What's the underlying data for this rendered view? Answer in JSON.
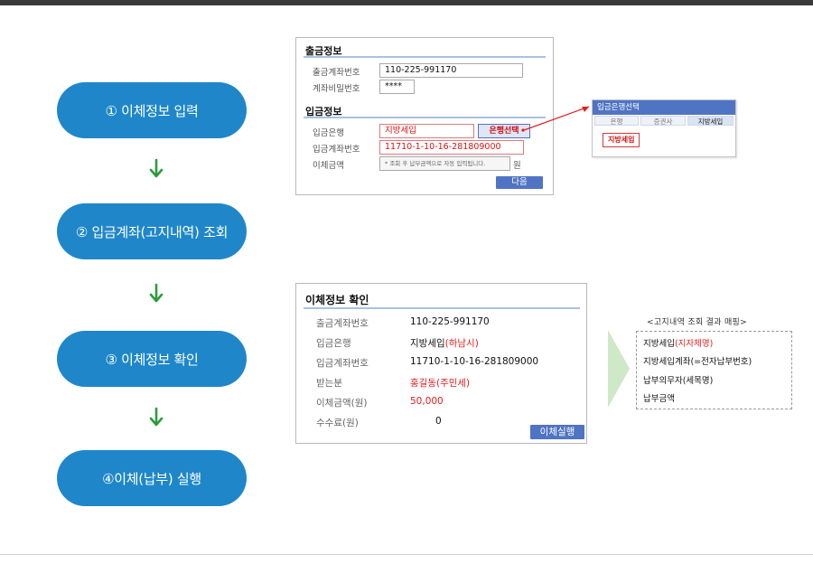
{
  "steps": [
    {
      "label": "① 이체정보 입력"
    },
    {
      "label": "② 입금계좌(고지내역) 조회"
    },
    {
      "label": "③ 이체정보 확인"
    },
    {
      "label": "④이체(납부) 실행"
    }
  ],
  "input_panel": {
    "withdraw_title": "출금정보",
    "withdraw_account_label": "출금계좌번호",
    "withdraw_account_value": "110-225-991170",
    "password_label": "계좌비밀번호",
    "password_value": "****",
    "deposit_title": "입금정보",
    "deposit_bank_label": "입금은행",
    "deposit_bank_value": "지방세입",
    "bank_select_button": "은행선택",
    "deposit_account_label": "입금계좌번호",
    "deposit_account_value": "11710-1-10-16-281809000",
    "amount_label": "이체금액",
    "amount_placeholder": "* 조회 후 납부금액으로 자동 입력됩니다.",
    "amount_unit": "원",
    "next_button": "다음"
  },
  "bank_popup": {
    "title": "입금은행선택",
    "tabs": [
      "은행",
      "증권사",
      "지방세입"
    ],
    "active_tab": "지방세입",
    "chip": "지방세입"
  },
  "confirm_panel": {
    "title": "이체정보 확인",
    "rows": [
      {
        "label": "출금계좌번호",
        "value": "110-225-991170",
        "suffix": ""
      },
      {
        "label": "입금은행",
        "value": "지방세입",
        "suffix": "(하남시)"
      },
      {
        "label": "입금계좌번호",
        "value": "11710-1-10-16-281809000",
        "suffix": ""
      },
      {
        "label": "받는분",
        "value": "홍길동(주민세)",
        "suffix": ""
      },
      {
        "label": "이체금액(원)",
        "value": "50,000",
        "suffix": ""
      },
      {
        "label": "수수료(원)",
        "value": "0",
        "suffix": ""
      }
    ],
    "execute_button": "이체실행"
  },
  "mapping": {
    "title": "<고지내역 조회 결과 매핑>",
    "lines": [
      {
        "black": "지방세입",
        "red": "(지자체명)"
      },
      {
        "black": "지방세입계좌(=전자납부번호)",
        "red": ""
      },
      {
        "black": "",
        "red": "납부의무자(세목명)"
      },
      {
        "black": "",
        "red": "납부금액"
      }
    ]
  },
  "colors": {
    "step_pill": "#1f87c9",
    "arrow": "#2e9a3e",
    "button_blue": "#4f74c4",
    "highlight_red": "#e02020",
    "chevron": "#cfe8c7"
  }
}
